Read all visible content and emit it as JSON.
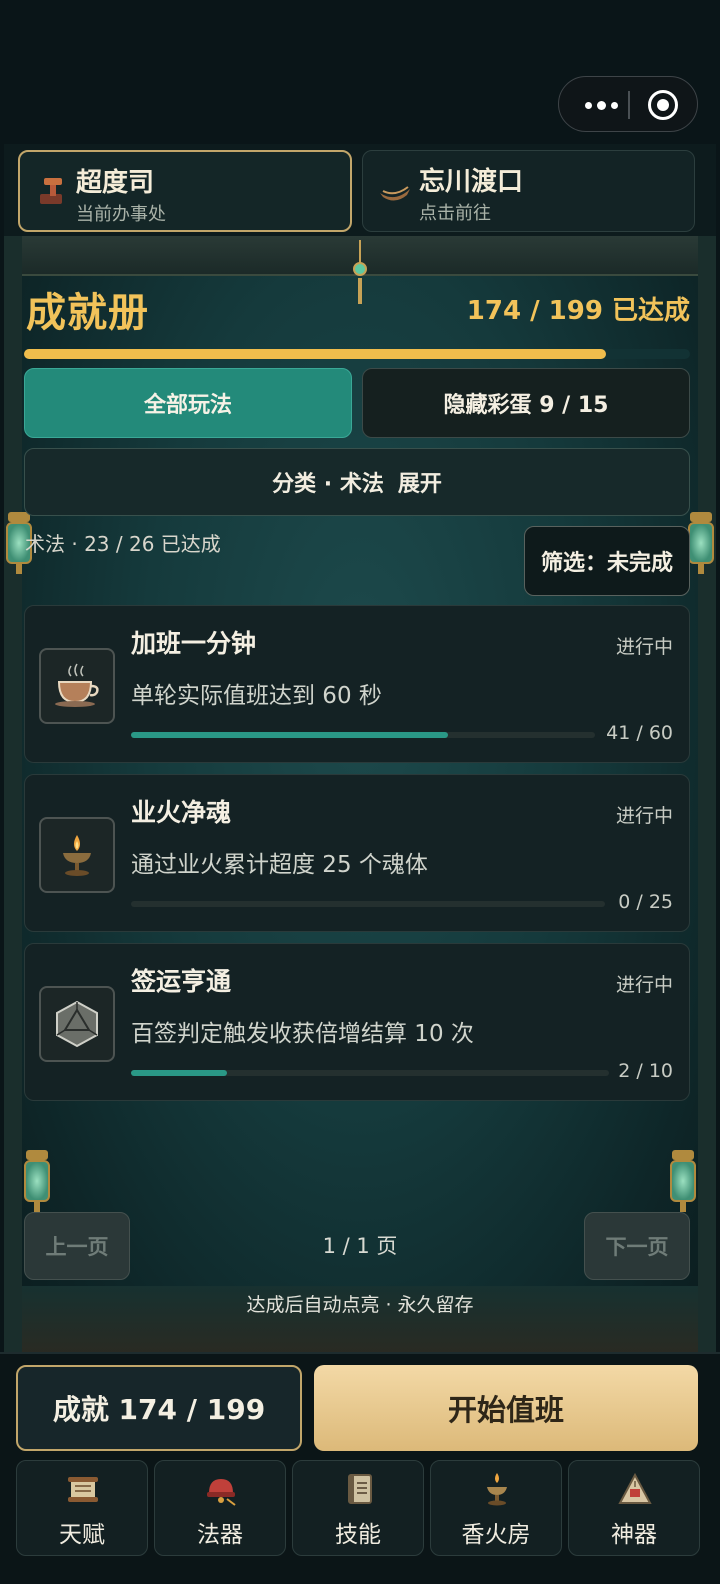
{
  "capsule": {
    "menu_icon": "more-dots-icon",
    "close_icon": "target-circle-icon"
  },
  "locations": [
    {
      "name": "超度司",
      "sub": "当前办事处",
      "icon": "hammer-icon"
    },
    {
      "name": "忘川渡口",
      "sub": "点击前往",
      "icon": "boat-icon"
    }
  ],
  "book": {
    "title": "成就册",
    "summary": "174 / 199 已达成",
    "achieved": 174,
    "total": 199
  },
  "tabs": [
    {
      "label": "全部玩法",
      "active": true
    },
    {
      "label": "隐藏彩蛋 9 / 15",
      "active": false
    }
  ],
  "category": {
    "label": "分类 · 术法",
    "action": "展开"
  },
  "category_status": "术法 · 23 / 26 已达成",
  "filter": "筛选：未完成",
  "achievements": [
    {
      "name": "加班一分钟",
      "state": "进行中",
      "desc": "单轮实际值班达到 60 秒",
      "progress_text": "41 / 60",
      "current": 41,
      "target": 60,
      "icon": "teacup-icon"
    },
    {
      "name": "业火净魂",
      "state": "进行中",
      "desc": "通过业火累计超度 25 个魂体",
      "progress_text": "0 / 25",
      "current": 0,
      "target": 25,
      "icon": "oil-lamp-icon"
    },
    {
      "name": "签运亨通",
      "state": "进行中",
      "desc": "百签判定触发收获倍增结算 10 次",
      "progress_text": "2 / 10",
      "current": 2,
      "target": 10,
      "icon": "dice-icon"
    }
  ],
  "pagination": {
    "prev": "上一页",
    "info": "1 / 1 页",
    "next": "下一页"
  },
  "note": "达成后自动点亮 · 永久留存",
  "actions": {
    "achievements": "成就 174 / 199",
    "start": "开始值班"
  },
  "nav": [
    {
      "label": "天赋",
      "icon": "scroll-icon"
    },
    {
      "label": "法器",
      "icon": "bell-icon"
    },
    {
      "label": "技能",
      "icon": "book-icon"
    },
    {
      "label": "香火房",
      "icon": "incense-lamp-icon"
    },
    {
      "label": "神器",
      "icon": "mountain-shrine-icon"
    }
  ],
  "colors": {
    "accent_gold": "#f2c35a",
    "teal": "#238a7a",
    "progress": "#2a9886"
  }
}
